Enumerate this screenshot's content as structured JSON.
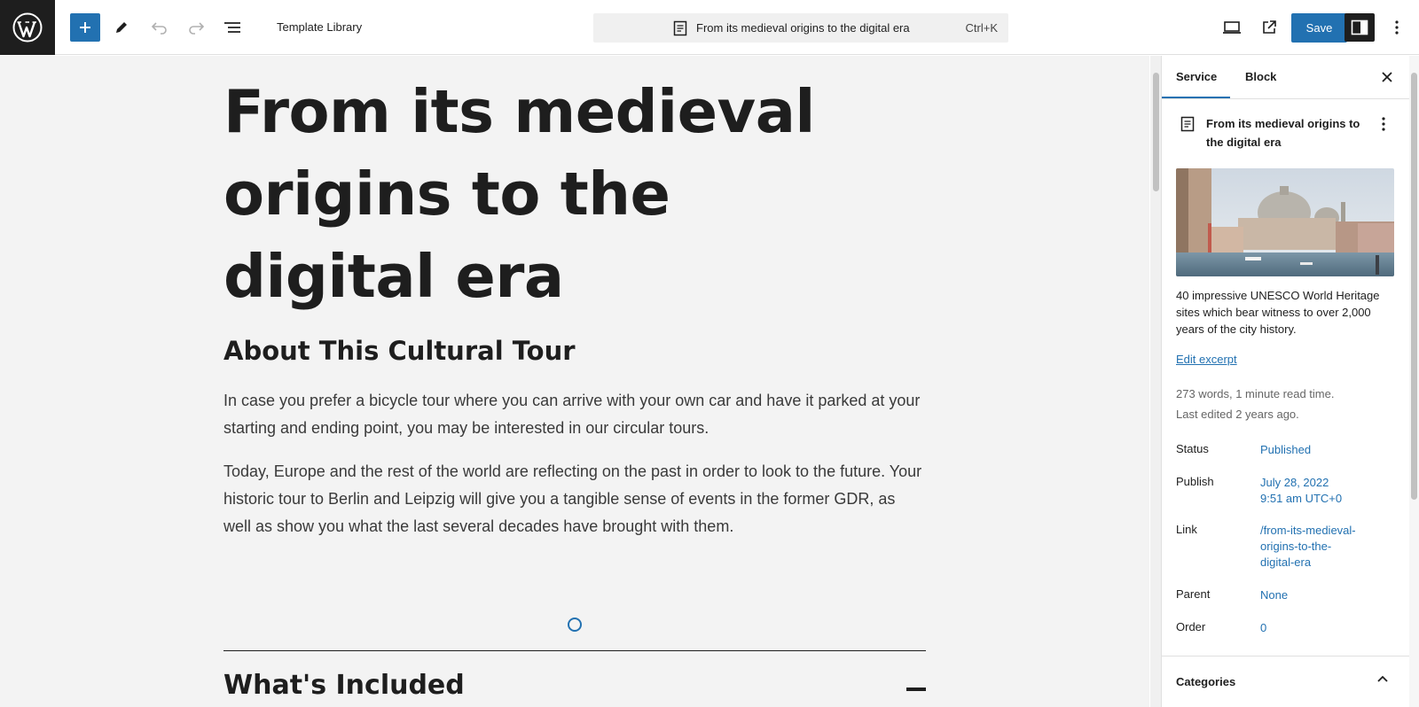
{
  "toolbar": {
    "template_library": "Template Library",
    "command_title": "From its medieval origins to the digital era",
    "command_shortcut": "Ctrl+K",
    "save_label": "Save",
    "accent_color": "#2271b1"
  },
  "canvas": {
    "post_title": "From its medieval origins to the digital era",
    "about_heading": "About This Cultural Tour",
    "paragraph1": "In case you prefer a bicycle tour where you can arrive with your own car and have it parked at your starting and ending point, you may be interested in our circular tours.",
    "paragraph2": "Today, Europe and the rest of the world are reflecting on the past in order to look to the future. Your historic tour to Berlin and Leipzig will give you a tangible sense of events in the former GDR, as well as show you what the last several decades have brought with them.",
    "included_heading": "What's Included"
  },
  "sidebar": {
    "tabs": [
      {
        "label": "Service"
      },
      {
        "label": "Block"
      }
    ],
    "post_title": "From its medieval origins to the digital era",
    "excerpt": "40 impressive UNESCO World Heritage sites which bear witness to over 2,000 years of the city history.",
    "edit_excerpt": "Edit excerpt",
    "word_count": "273 words, 1 minute read time.",
    "last_edited": "Last edited 2 years ago.",
    "rows": {
      "status": {
        "label": "Status",
        "value": "Published"
      },
      "publish": {
        "label": "Publish",
        "value_line1": "July 28, 2022",
        "value_line2": "9:51 am UTC+0"
      },
      "link": {
        "label": "Link",
        "value_line1": "/from-its-medieval-",
        "value_line2": "origins-to-the-",
        "value_line3": "digital-era"
      },
      "parent": {
        "label": "Parent",
        "value": "None"
      },
      "order": {
        "label": "Order",
        "value": "0"
      }
    },
    "categories": "Categories"
  }
}
